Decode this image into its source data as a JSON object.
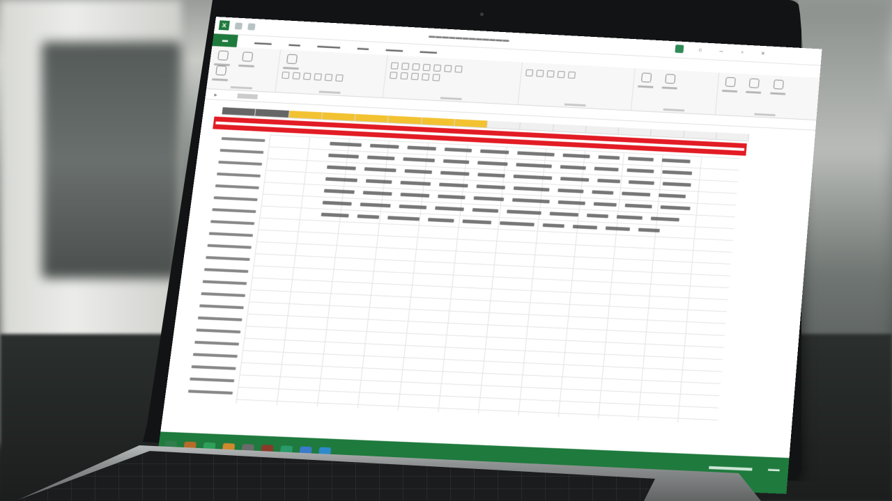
{
  "scene": {
    "description_kind": "photo",
    "colors": {
      "excel_green": "#1f7a3d",
      "highlight_red": "#e21b24",
      "selected_column": "#f2c231"
    }
  },
  "screen": {
    "app": "spreadsheet",
    "file_tab_icon": "excel-logo-icon",
    "highlighted_row": "red-band"
  }
}
